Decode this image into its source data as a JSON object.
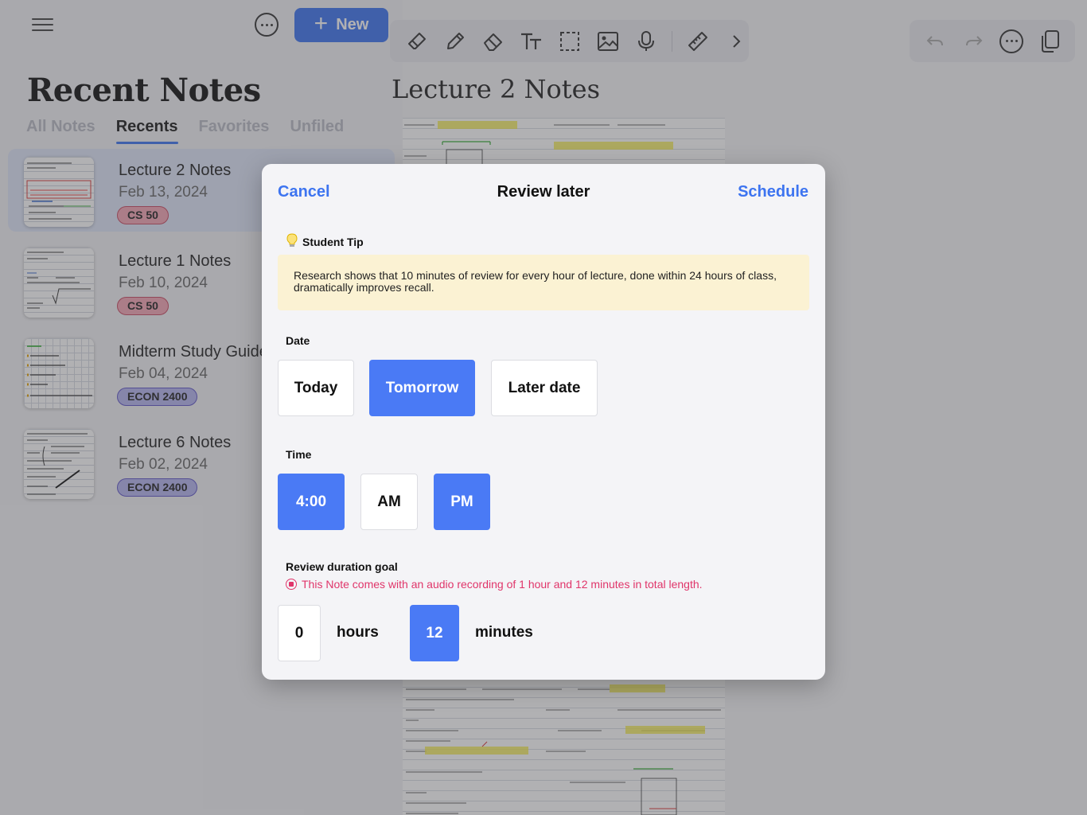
{
  "sidebar": {
    "new_label": "New",
    "title": "Recent Notes",
    "tabs": [
      {
        "label": "All Notes"
      },
      {
        "label": "Recents"
      },
      {
        "label": "Favorites"
      },
      {
        "label": "Unfiled"
      }
    ],
    "notes": [
      {
        "title": "Lecture 2 Notes",
        "date": "Feb 13, 2024",
        "course": "CS 50"
      },
      {
        "title": "Lecture 1 Notes",
        "date": "Feb 10, 2024",
        "course": "CS 50"
      },
      {
        "title": "Midterm Study Guide",
        "date": "Feb 04, 2024",
        "course": "ECON 2400"
      },
      {
        "title": "Lecture 6 Notes",
        "date": "Feb 02, 2024",
        "course": "ECON 2400"
      }
    ]
  },
  "document": {
    "title": "Lecture 2 Notes",
    "toolbar_icons": [
      "eraser-icon",
      "pencil-icon",
      "highlighter-eraser-icon",
      "text-tool-icon",
      "lasso-select-icon",
      "image-icon",
      "microphone-icon",
      "ruler-icon",
      "chevron-right-icon"
    ],
    "right_icons": [
      "undo-icon",
      "redo-icon",
      "more-icon",
      "copy-icon"
    ]
  },
  "modal": {
    "cancel": "Cancel",
    "title": "Review later",
    "schedule": "Schedule",
    "tip_heading": "Student Tip",
    "tip_text": "Research shows that 10 minutes of review for every hour of lecture, done within 24 hours of class, dramatically improves recall.",
    "date_label": "Date",
    "date_options": [
      {
        "label": "Today",
        "selected": false
      },
      {
        "label": "Tomorrow",
        "selected": true
      },
      {
        "label": "Later date",
        "selected": false
      }
    ],
    "time_label": "Time",
    "time_value": "4:00",
    "am_label": "AM",
    "pm_label": "PM",
    "meridiem_selected": "PM",
    "duration_label": "Review duration goal",
    "audio_note": "This Note comes with an audio recording of 1 hour and 12 minutes in total length.",
    "hours_value": "0",
    "hours_label": "hours",
    "minutes_value": "12",
    "minutes_label": "minutes"
  },
  "colors": {
    "accent": "#3d74f0",
    "selected_option": "#4a7af5",
    "tip_background": "#fbf2d3",
    "audio_warning": "#e0356a",
    "badge_cs": "#f5a5b5",
    "badge_econ": "#b6b6ef"
  }
}
